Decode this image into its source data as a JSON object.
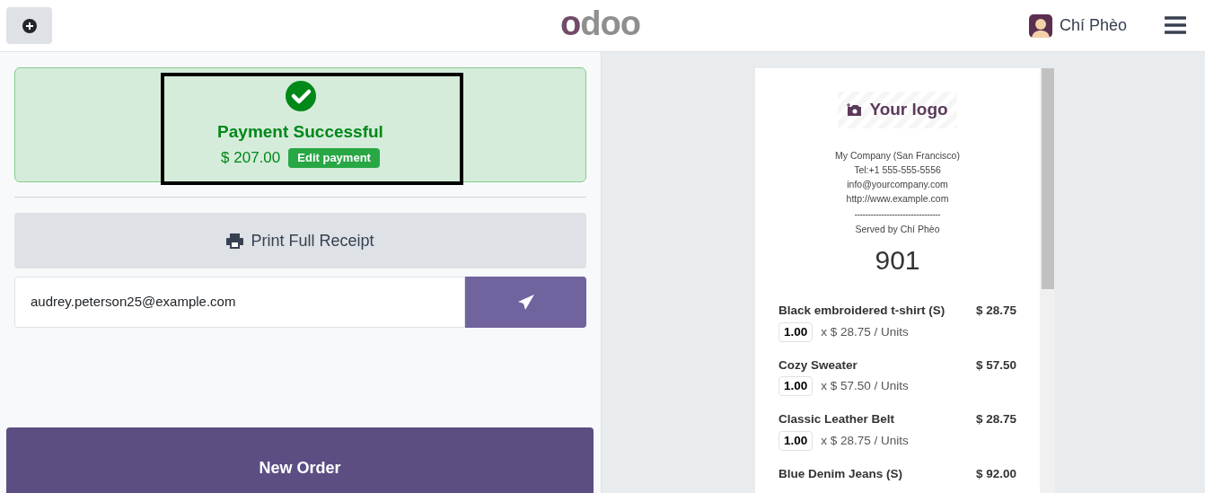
{
  "header": {
    "logo": [
      "o",
      "doo"
    ],
    "user": "Chí Phèo"
  },
  "payment": {
    "title": "Payment Successful",
    "amount": "$ 207.00",
    "edit_button": "Edit payment",
    "highlighted": true
  },
  "print_button": "Print Full Receipt",
  "email_field": {
    "value": "audrey.peterson25@example.com"
  },
  "new_order_button": "New Order",
  "receipt": {
    "logo_text": "Your logo",
    "company_lines": [
      "My Company (San Francisco)",
      "Tel:+1 555-555-5556",
      "info@yourcompany.com",
      "http://www.example.com"
    ],
    "separator": "--------------------------------",
    "served_by": "Served by Chí Phèo",
    "order_number": "901",
    "lines": [
      {
        "name": "Black embroidered t-shirt (S)",
        "price": "$ 28.75",
        "qty": "1.00",
        "unit": "x $ 28.75 / Units"
      },
      {
        "name": "Cozy Sweater",
        "price": "$ 57.50",
        "qty": "1.00",
        "unit": "x $ 57.50 / Units"
      },
      {
        "name": "Classic Leather Belt",
        "price": "$ 28.75",
        "qty": "1.00",
        "unit": "x $ 28.75 / Units"
      },
      {
        "name": "Blue Denim Jeans (S)",
        "price": "$ 92.00"
      }
    ]
  }
}
